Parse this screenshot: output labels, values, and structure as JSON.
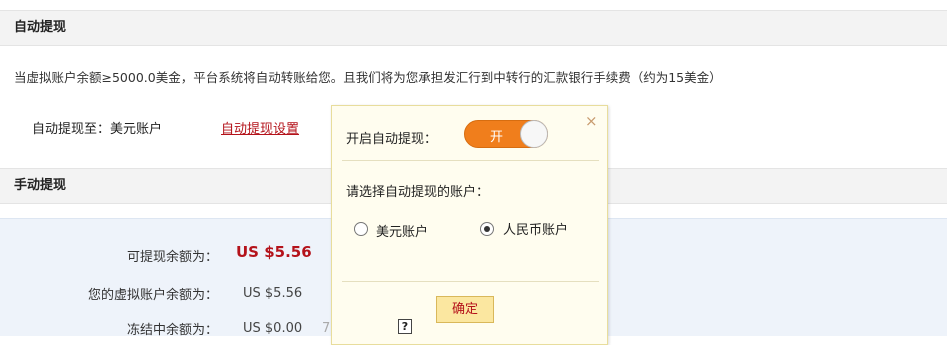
{
  "auto_section": {
    "header": "自动提现",
    "notice": "当虚拟账户余额≥5000.0美金，平台系统将自动转账给您。且我们将为您承担发汇行到中转行的汇款银行手续费（约为15美金）",
    "target_label": "自动提现至：美元账户",
    "settings_link": "自动提现设置"
  },
  "manual_section": {
    "header": "手动提现",
    "balances": [
      {
        "label": "可提现余额为：",
        "value": "US $5.56"
      },
      {
        "label": "您的虚拟账户余额为：",
        "value": "US $5.56"
      },
      {
        "label": "冻结中余额为：",
        "value": "US $0.00"
      }
    ],
    "truncated": "7"
  },
  "popup": {
    "close_icon": "×",
    "enable_label": "开启自动提现：",
    "toggle": {
      "state_label": "开",
      "on": true,
      "color": "#f07e1c"
    },
    "select_label": "请选择自动提现的账户：",
    "options": [
      {
        "label": "美元账户",
        "selected": false
      },
      {
        "label": "人民币账户",
        "selected": true
      }
    ],
    "confirm_button": "确定",
    "help_icon": "?"
  }
}
